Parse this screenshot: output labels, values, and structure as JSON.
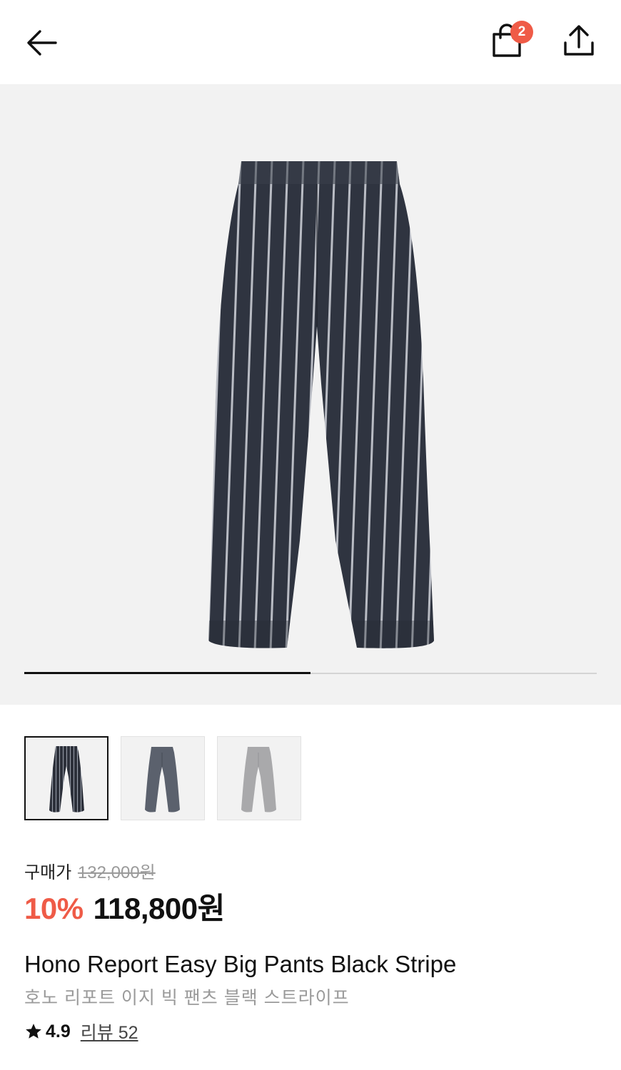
{
  "header": {
    "back_icon": "arrow-left-icon",
    "cart_icon": "shopping-bag-icon",
    "cart_count": "2",
    "share_icon": "share-upload-icon"
  },
  "gallery": {
    "image_alt": "pants-product-photo",
    "slide_progress": 0.5
  },
  "thumbnails": [
    {
      "color": "black-stripe",
      "selected": true
    },
    {
      "color": "charcoal",
      "selected": false
    },
    {
      "color": "light-gray",
      "selected": false
    }
  ],
  "price": {
    "label": "구매가",
    "original": "132,000원",
    "discount": "10%",
    "final": "118,800원"
  },
  "product": {
    "name_en": "Hono Report Easy Big Pants Black Stripe",
    "name_ko": "호노 리포트 이지 빅 팬츠 블랙 스트라이프"
  },
  "rating": {
    "star_icon": "star-icon",
    "score": "4.9",
    "reviews": "리뷰 52"
  },
  "colors": {
    "accent": "#ef5b47",
    "text": "#111111",
    "muted": "#9a9a9a",
    "hero_bg": "#f2f2f2"
  }
}
